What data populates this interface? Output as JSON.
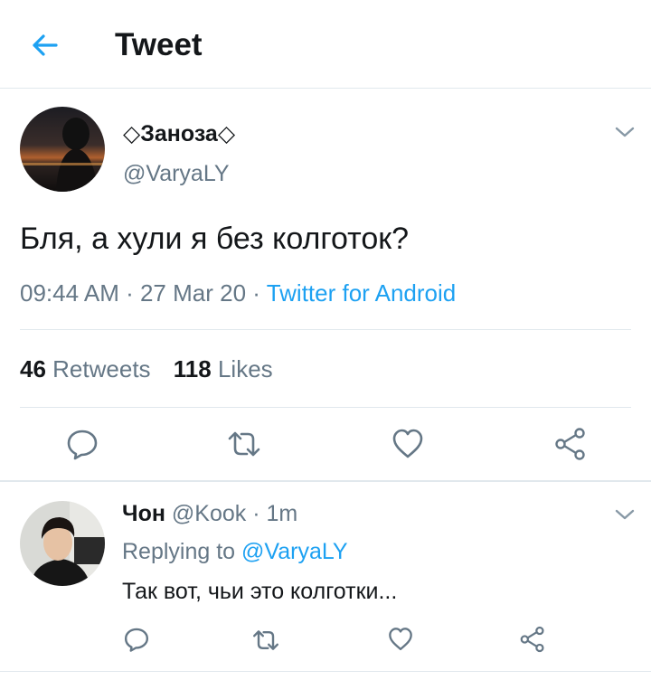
{
  "header": {
    "title": "Tweet"
  },
  "tweet": {
    "display_name": "◇Заноза◇",
    "handle": "@VaryaLY",
    "text": "Бля, а хули я без колготок?",
    "time": "09:44 AM",
    "dot1": " · ",
    "date": "27 Mar 20",
    "dot2": " · ",
    "source": "Twitter for Android",
    "retweets_count": "46",
    "retweets_label": "Retweets",
    "likes_count": "118",
    "likes_label": "Likes"
  },
  "reply": {
    "display_name": "Чон",
    "handle": "@Kook",
    "dot": " · ",
    "time": "1m",
    "replying_to_label": "Replying to",
    "replying_to_handle": "@VaryaLY",
    "text": "Так вот, чьи это колготки..."
  },
  "colors": {
    "accent": "#1da1f2",
    "secondary": "#657786",
    "divider": "#e1e8ed",
    "icon": "#657786"
  },
  "icons": [
    "back-arrow-icon",
    "chevron-down-icon",
    "reply-icon",
    "retweet-icon",
    "like-icon",
    "share-icon"
  ]
}
